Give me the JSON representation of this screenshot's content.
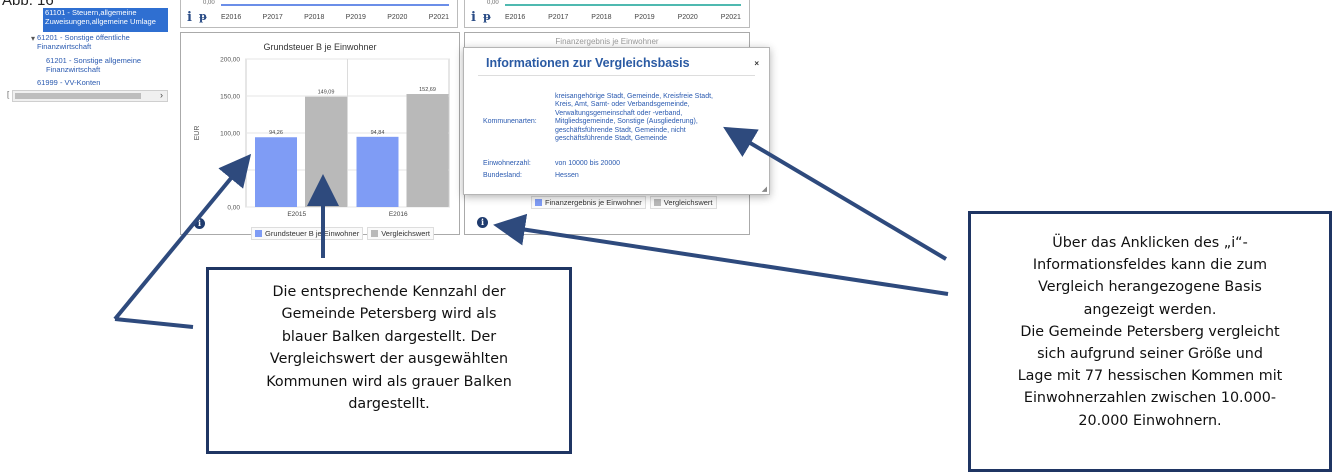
{
  "figure_label": "Abb. 16",
  "sidebar": {
    "selected_item": "61101 - Steuern,allgemeine Zuweisungen,allgemeine Umlage",
    "items": [
      {
        "label": "61201 - Sonstige öffentliche Finanzwirtschaft"
      },
      {
        "label": "61201 - Sonstige allgemeine Finanzwirtschaft"
      },
      {
        "label": "61999 - VV-Konten"
      }
    ]
  },
  "top_strips": [
    {
      "axis_zero": "0,00",
      "ticks": [
        "E2016",
        "P2017",
        "P2018",
        "P2019",
        "P2020",
        "P2021"
      ],
      "icon": "i",
      "line_color": "#6b8ee8"
    },
    {
      "axis_zero": "0,00",
      "ticks": [
        "E2016",
        "P2017",
        "P2018",
        "P2019",
        "P2020",
        "P2021"
      ],
      "icon": "i",
      "line_color": "#4fb9b0"
    }
  ],
  "chart_data": {
    "type": "bar",
    "title": "Grundsteuer B je Einwohner",
    "ylabel": "EUR",
    "ylim": [
      0,
      200
    ],
    "yticks": [
      "0,00",
      "50,00",
      "100,00",
      "150,00",
      "200,00"
    ],
    "categories": [
      "E2015",
      "E2016"
    ],
    "series": [
      {
        "name": "Grundsteuer B je Einwohner",
        "values": [
          94.26,
          94.84
        ],
        "labels": [
          "94,26",
          "94,84"
        ],
        "color": "#7f9cf5"
      },
      {
        "name": "Vergleichswert",
        "values": [
          149.09,
          152.69
        ],
        "labels": [
          "149,09",
          "152,69"
        ],
        "color": "#b9b9b9"
      }
    ]
  },
  "panel2": {
    "title": "Finanzergebnis je Einwohner",
    "legend": [
      "Finanzergebnis je Einwohner",
      "Vergleichswert"
    ]
  },
  "modal": {
    "title": "Informationen zur Vergleichsbasis",
    "close": "×",
    "kommunenarten_label": "Kommunenarten:",
    "kommunenarten_lines": [
      "kreisangehörige Stadt, Gemeinde, Kreisfreie Stadt,",
      "Kreis, Amt, Samt- oder Verbandsgemeinde,",
      "Verwaltungsgemeinschaft oder -verband,",
      "Mitgliedsgemeinde, Sonstige (Ausgliederung),",
      "geschäftsführende Stadt, Gemeinde, nicht",
      "geschäftsführende Stadt, Gemeinde"
    ],
    "einwohnerzahl_label": "Einwohnerzahl:",
    "einwohnerzahl_value": "von 10000 bis 20000",
    "bundesland_label": "Bundesland:",
    "bundesland_value": "Hessen"
  },
  "callouts": {
    "left": [
      "Die entsprechende Kennzahl der",
      "Gemeinde Petersberg wird als",
      "blauer Balken dargestellt. Der",
      "Vergleichswert der ausgewählten",
      "Kommunen wird als grauer Balken",
      "dargestellt."
    ],
    "right": [
      "Über das Anklicken des „i“-",
      "Informationsfeldes kann die zum",
      "Vergleich herangezogene Basis",
      "angezeigt werden.",
      "Die Gemeinde Petersberg vergleicht",
      "sich aufgrund seiner Größe und",
      "Lage mit 77 hessischen Kommen mit",
      "Einwohnerzahlen zwischen 10.000-",
      "20.000 Einwohnern."
    ]
  },
  "colors": {
    "callout_border": "#1f3563",
    "arrow": "#2e4a7d",
    "accent": "#2a5aa3"
  }
}
